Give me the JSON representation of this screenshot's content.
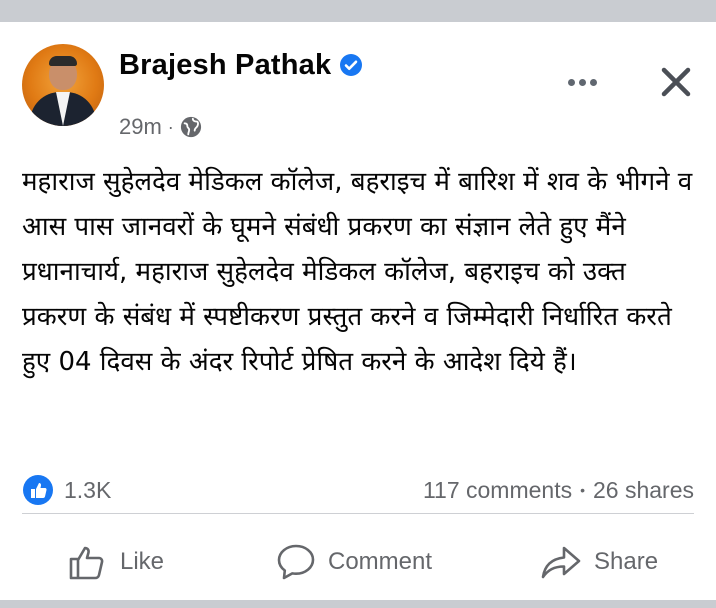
{
  "post": {
    "author": "Brajesh Pathak",
    "time": "29m",
    "separator": "·",
    "text": "महाराज सुहेलदेव मेडिकल कॉलेज, बहराइच में बारिश में शव के भीगने व आस पास जानवरों के घूमने संबंधी प्रकरण का संज्ञान लेते हुए मैंने प्रधानाचार्य, महाराज सुहेलदेव मेडिकल कॉलेज, बहराइच को उक्त प्रकरण के संबंध में स्पष्टीकरण प्रस्तुत करने व जिम्मेदारी निर्धारित करते हुए 04 दिवस के अंदर रिपोर्ट प्रेषित करने के आदेश दिये हैं।"
  },
  "stats": {
    "likes": "1.3K",
    "comments": "117 comments",
    "bullet": "•",
    "shares": "26 shares"
  },
  "actions": {
    "like": "Like",
    "comment": "Comment",
    "share": "Share"
  },
  "icons": [
    "verified-badge-icon",
    "globe-icon",
    "more-options-icon",
    "close-icon",
    "like-reaction-icon",
    "thumbs-up-icon",
    "comment-icon",
    "share-icon"
  ],
  "colors": {
    "accent": "#1877f2",
    "muted": "#65676b",
    "text": "#050505",
    "backdrop": "#c9ccd1"
  }
}
